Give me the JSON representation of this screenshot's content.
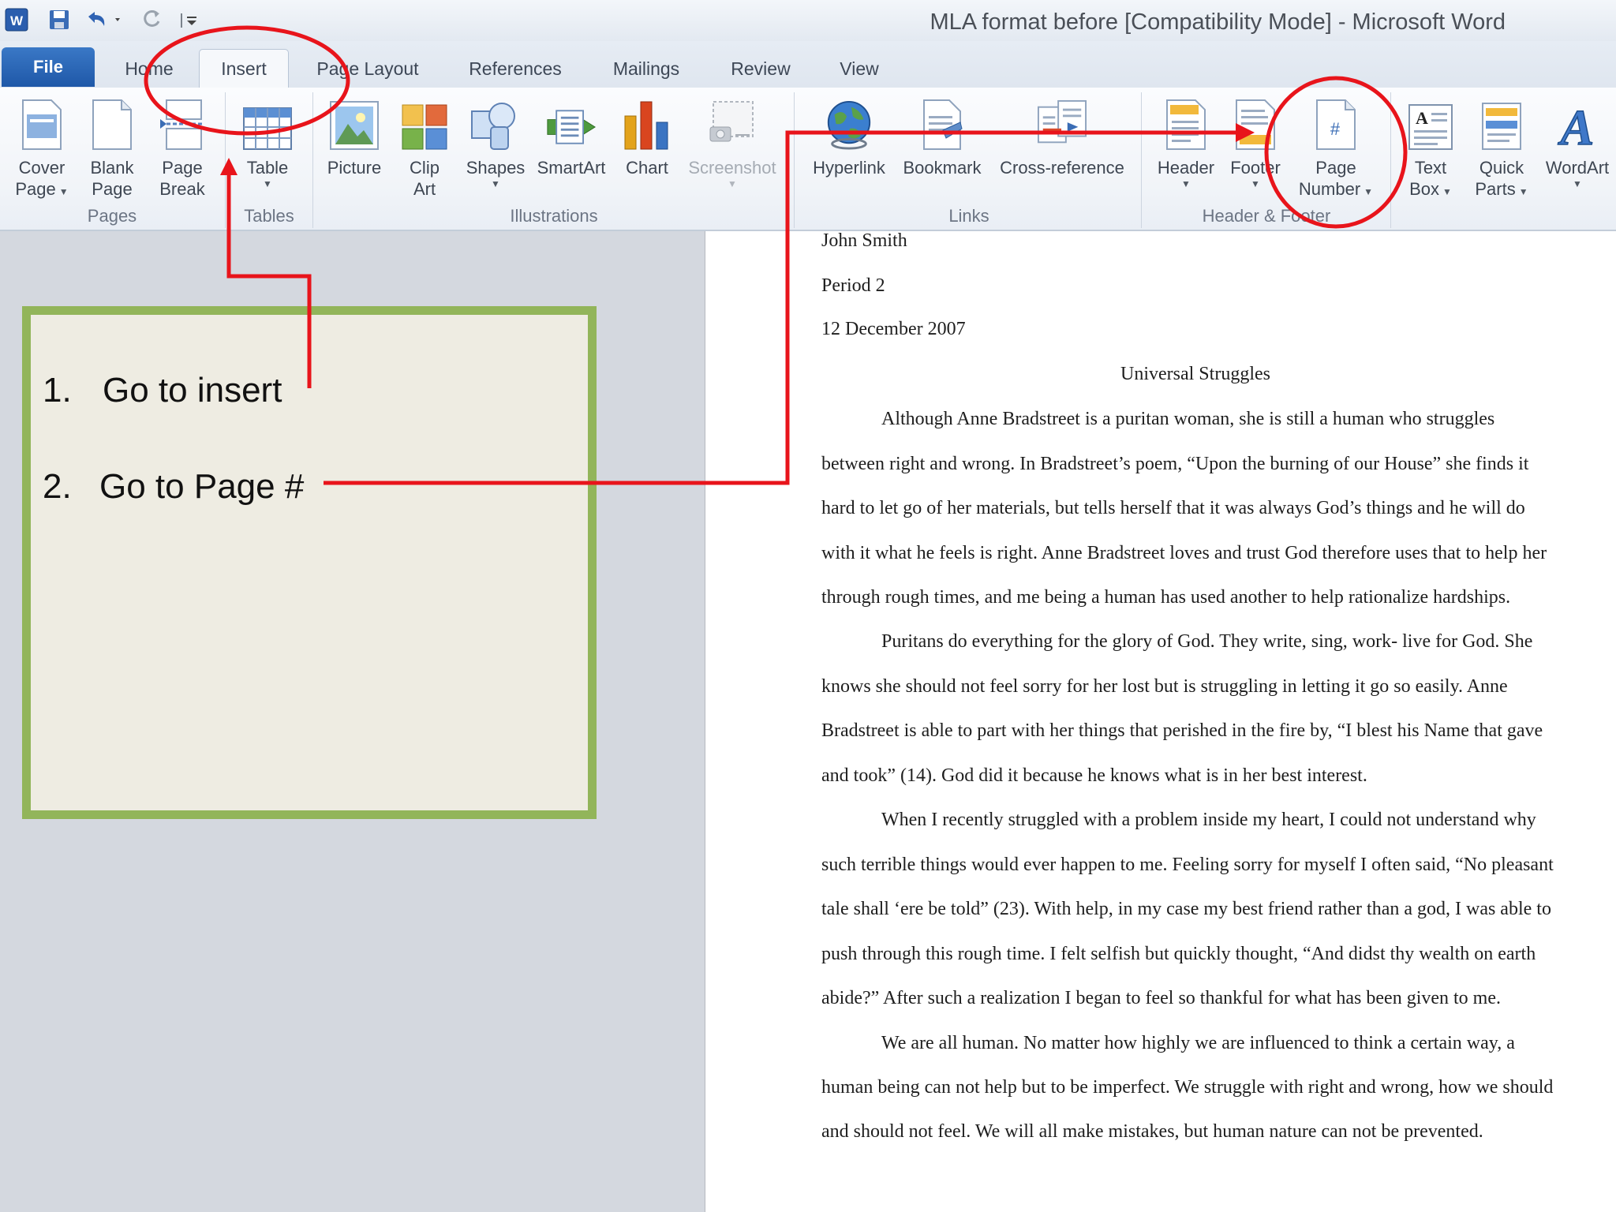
{
  "window": {
    "title": "MLA format before [Compatibility Mode]  -  Microsoft Word",
    "qat": [
      "word-icon",
      "save-icon",
      "undo-icon",
      "redo-icon",
      "customize-icon"
    ]
  },
  "tabs": [
    "File",
    "Home",
    "Insert",
    "Page Layout",
    "References",
    "Mailings",
    "Review",
    "View"
  ],
  "active_tab": "Insert",
  "ribbon": {
    "cover_page": [
      "Cover",
      "Page"
    ],
    "blank_page": [
      "Blank",
      "Page"
    ],
    "page_break": [
      "Page",
      "Break"
    ],
    "table": "Table",
    "picture": "Picture",
    "clip_art": [
      "Clip",
      "Art"
    ],
    "shapes": "Shapes",
    "smartart": "SmartArt",
    "chart": "Chart",
    "screenshot": "Screenshot",
    "hyperlink": "Hyperlink",
    "bookmark": "Bookmark",
    "cross_reference": "Cross-reference",
    "header": "Header",
    "footer": "Footer",
    "page_number": [
      "Page",
      "Number"
    ],
    "text_box": [
      "Text",
      "Box"
    ],
    "quick_parts": [
      "Quick",
      "Parts"
    ],
    "wordart": "WordArt",
    "groups": {
      "pages": "Pages",
      "tables": "Tables",
      "illustrations": "Illustrations",
      "links": "Links",
      "header_footer": "Header & Footer"
    }
  },
  "document": {
    "lines": [
      "John Smith",
      "Period 2",
      "12 December 2007",
      "Universal Struggles",
      "Although Anne Bradstreet is a puritan woman, she is still a human who struggles",
      "between right and wrong. In Bradstreet’s poem, “Upon the burning of our House” she finds it",
      "hard to let go of her materials, but tells  herself that it was always God’s things and he will do",
      "with it what he feels is right. Anne Bradstreet loves and trust God therefore uses that to help her",
      "through rough times, and me being a human has used another to help rationalize hardships.",
      "Puritans do everything for the glory of God. They write, sing, work- live for God. She",
      "knows she should not feel sorry for her lost but is struggling in letting it go so easily. Anne",
      "Bradstreet is able to part with her things that perished in the fire by, “I blest his Name that gave",
      "and took” (14).  God did it because he knows what is in her best interest.",
      "When I recently struggled with a problem inside my heart, I could not understand why",
      "such terrible things would ever happen to me. Feeling sorry for myself I often said, “No pleasant",
      "tale shall ‘ere be told” (23). With help, in my case my best friend rather than a god, I was able to",
      "push through this rough time. I felt selfish but quickly thought, “And didst thy wealth on earth",
      "abide?” After such a realization  I began to feel  so thankful for what has been given to me.",
      "We are all human. No matter how highly we are influenced to think a certain  way, a",
      "human being can not help but to be imperfect. We struggle with right and wrong, how we should",
      "and should not feel.  We will all  make mistakes, but human nature can not be prevented."
    ]
  },
  "instructions": {
    "step1_num": "1.",
    "step1_text": "Go to insert",
    "step2_num": "2.",
    "step2_text": "Go to Page #"
  },
  "colors": {
    "annotation_red": "#e8141b",
    "box_border": "#92b55a",
    "box_fill": "#eeece2",
    "file_tab": "#2a65b5"
  }
}
